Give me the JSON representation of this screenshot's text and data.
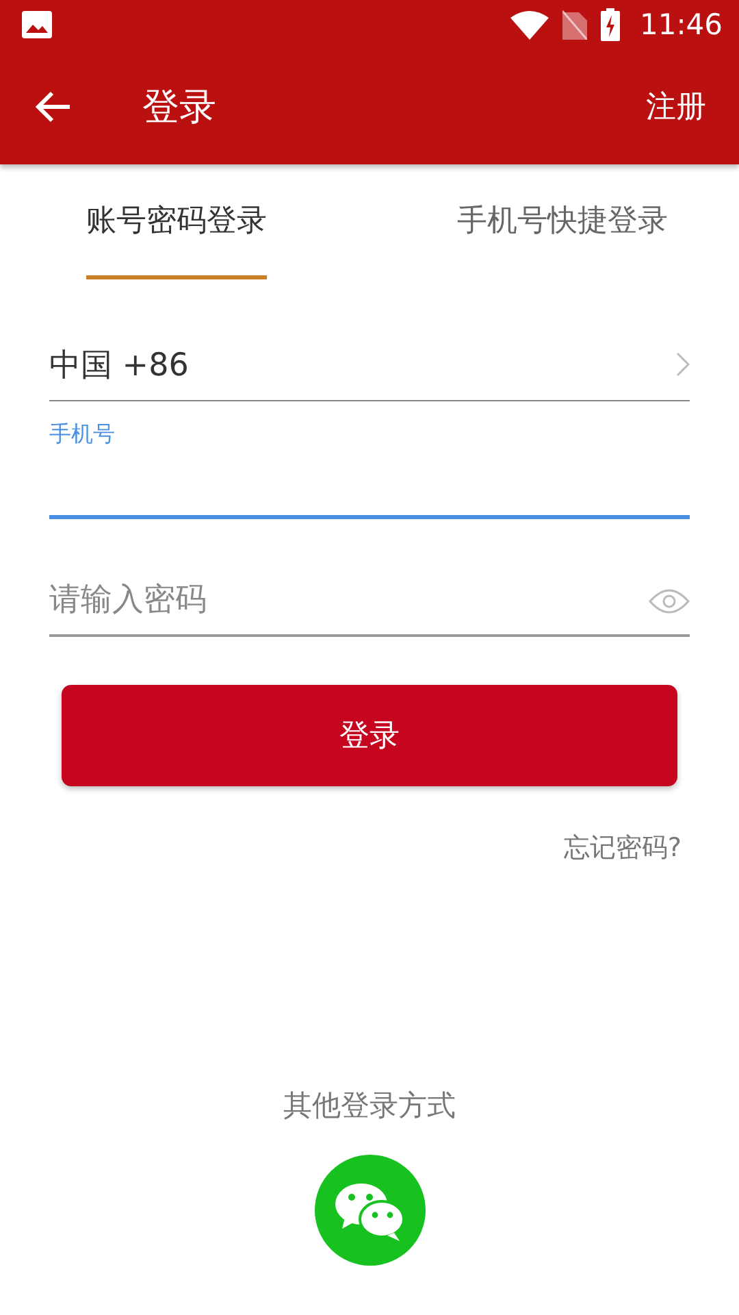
{
  "status_bar": {
    "time": "11:46"
  },
  "app_bar": {
    "title": "登录",
    "action": "注册"
  },
  "tabs": [
    {
      "label": "账号密码登录",
      "selected": true
    },
    {
      "label": "手机号快捷登录",
      "selected": false
    }
  ],
  "country": {
    "value": "中国 +86"
  },
  "phone": {
    "label": "手机号",
    "focused": true
  },
  "password": {
    "placeholder": "请输入密码"
  },
  "login_button": "登录",
  "forgot": "忘记密码?",
  "other_login": {
    "title": "其他登录方式"
  }
}
